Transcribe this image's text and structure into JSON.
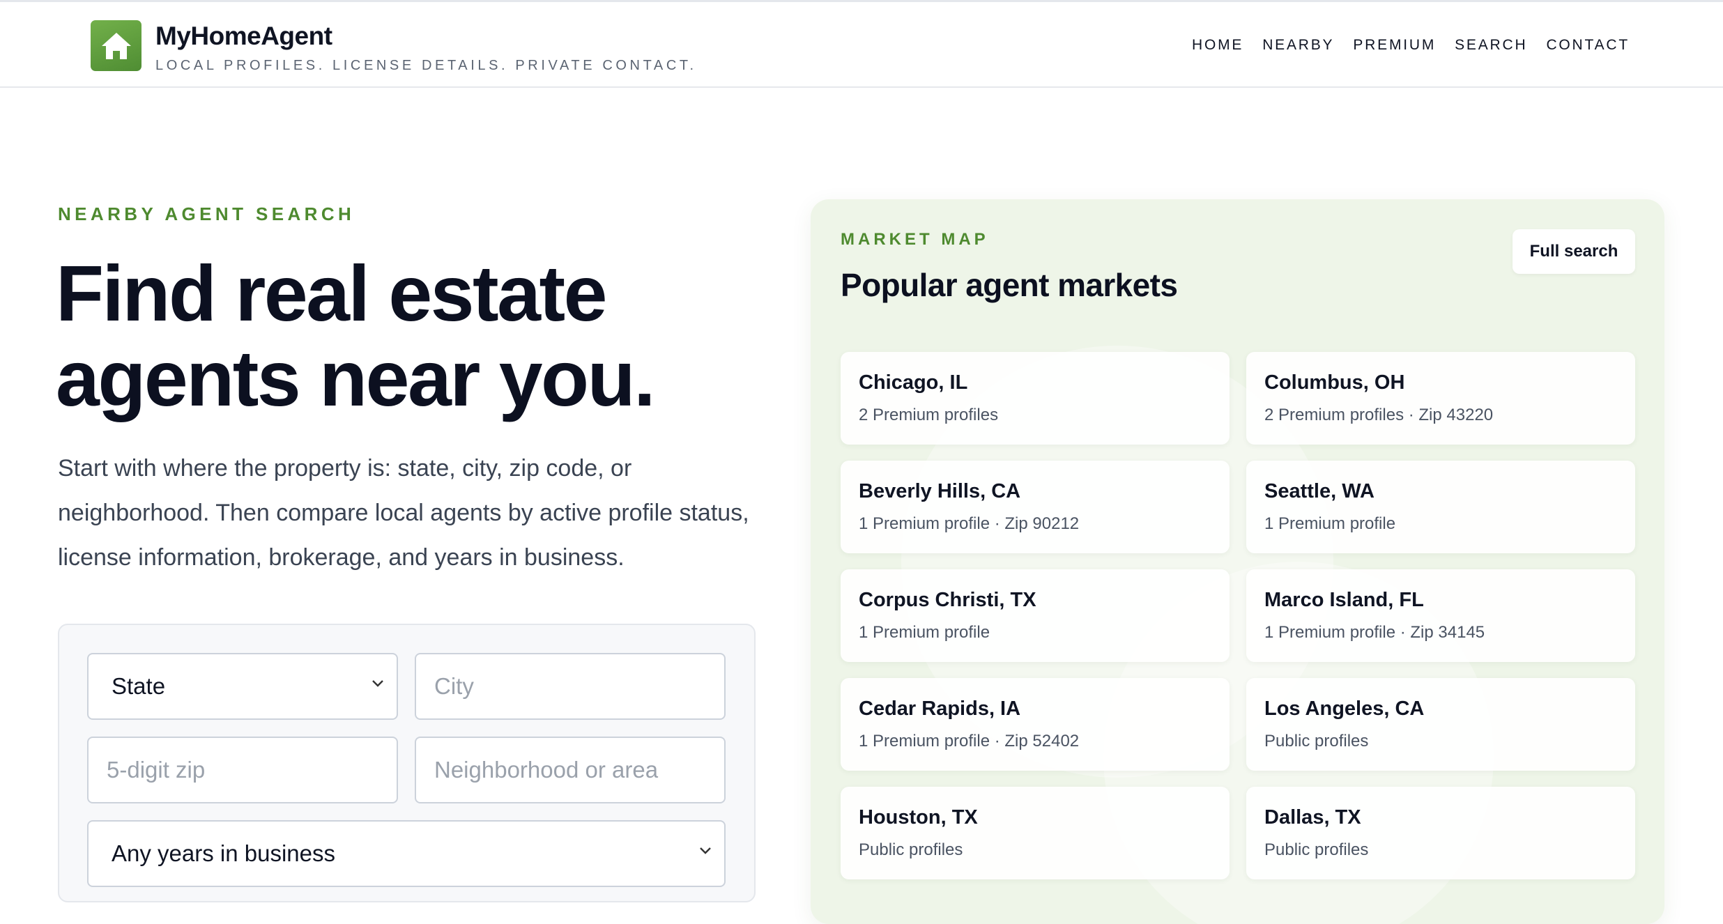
{
  "brand": {
    "name": "MyHomeAgent",
    "tagline": "LOCAL PROFILES. LICENSE DETAILS. PRIVATE CONTACT.",
    "logo_icon": "house-icon",
    "accent_color": "#5a9a3a"
  },
  "nav": [
    {
      "label": "HOME"
    },
    {
      "label": "NEARBY"
    },
    {
      "label": "PREMIUM"
    },
    {
      "label": "SEARCH"
    },
    {
      "label": "CONTACT"
    }
  ],
  "hero": {
    "eyebrow": "NEARBY AGENT SEARCH",
    "title_line1": "Find real estate",
    "title_line2": "agents near you.",
    "copy": "Start with where the property is: state, city, zip code, or neighborhood. Then compare local agents by active profile status, license information, brokerage, and years in business."
  },
  "search_form": {
    "state_selected": "State",
    "city_placeholder": "City",
    "zip_placeholder": "5-digit zip",
    "neighborhood_placeholder": "Neighborhood or area",
    "years_selected": "Any years in business"
  },
  "market": {
    "eyebrow": "MARKET MAP",
    "title": "Popular agent markets",
    "full_search_label": "Full search",
    "cards": [
      {
        "city": "Chicago, IL",
        "meta": "2 Premium profiles"
      },
      {
        "city": "Columbus, OH",
        "meta": "2 Premium profiles · Zip 43220"
      },
      {
        "city": "Beverly Hills, CA",
        "meta": "1 Premium profile · Zip 90212"
      },
      {
        "city": "Seattle, WA",
        "meta": "1 Premium profile"
      },
      {
        "city": "Corpus Christi, TX",
        "meta": "1 Premium profile"
      },
      {
        "city": "Marco Island, FL",
        "meta": "1 Premium profile · Zip 34145"
      },
      {
        "city": "Cedar Rapids, IA",
        "meta": "1 Premium profile · Zip 52402"
      },
      {
        "city": "Los Angeles, CA",
        "meta": "Public profiles"
      },
      {
        "city": "Houston, TX",
        "meta": "Public profiles"
      },
      {
        "city": "Dallas, TX",
        "meta": "Public profiles"
      }
    ]
  }
}
